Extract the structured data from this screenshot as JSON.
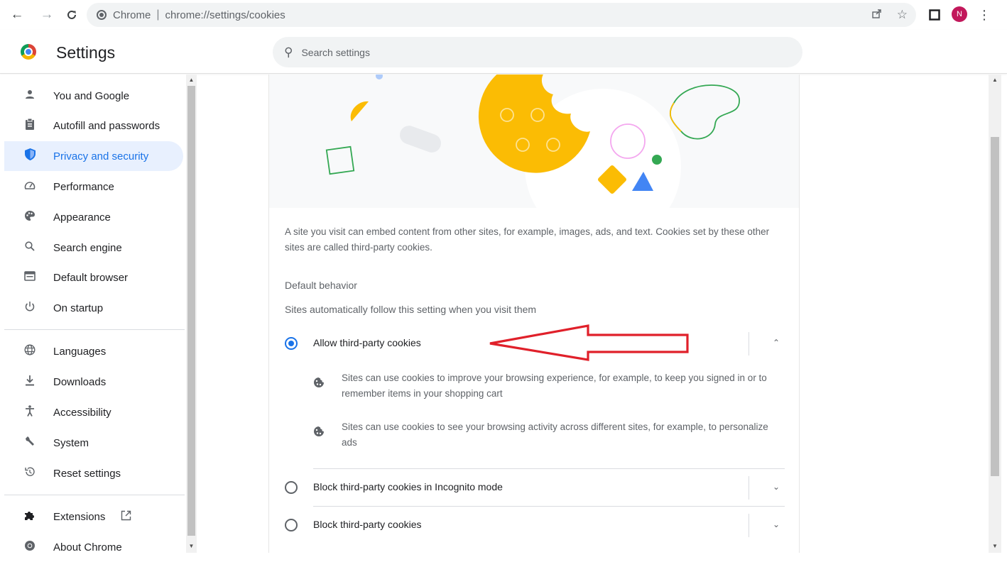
{
  "browser": {
    "site_name": "Chrome",
    "url": "chrome://settings/cookies",
    "profile_initial": "N",
    "icons": [
      "back-arrow-icon",
      "forward-arrow-icon",
      "reload-icon",
      "share-icon",
      "bookmark-star-icon",
      "side-panel-icon",
      "menu-dots-icon"
    ]
  },
  "header": {
    "title": "Settings",
    "search_placeholder": "Search settings"
  },
  "sidebar": {
    "items": [
      {
        "label": "You and Google",
        "icon": "person-icon"
      },
      {
        "label": "Autofill and passwords",
        "icon": "clipboard-icon"
      },
      {
        "label": "Privacy and security",
        "icon": "shield-icon",
        "active": true
      },
      {
        "label": "Performance",
        "icon": "speedometer-icon"
      },
      {
        "label": "Appearance",
        "icon": "palette-icon"
      },
      {
        "label": "Search engine",
        "icon": "search-icon"
      },
      {
        "label": "Default browser",
        "icon": "browser-window-icon"
      },
      {
        "label": "On startup",
        "icon": "power-icon"
      },
      {
        "label": "Languages",
        "icon": "globe-icon"
      },
      {
        "label": "Downloads",
        "icon": "download-icon"
      },
      {
        "label": "Accessibility",
        "icon": "accessibility-icon"
      },
      {
        "label": "System",
        "icon": "wrench-icon"
      },
      {
        "label": "Reset settings",
        "icon": "reset-icon"
      },
      {
        "label": "Extensions",
        "icon": "puzzle-icon"
      },
      {
        "label": "About Chrome",
        "icon": "chrome-icon"
      }
    ]
  },
  "main": {
    "description": "A site you visit can embed content from other sites, for example, images, ads, and text. Cookies set by these other sites are called third-party cookies.",
    "default_behavior_heading": "Default behavior",
    "default_behavior_sub": "Sites automatically follow this setting when you visit them",
    "options": [
      {
        "label": "Allow third-party cookies",
        "selected": true,
        "expanded": true
      },
      {
        "label": "Block third-party cookies in Incognito mode",
        "selected": false,
        "expanded": false
      },
      {
        "label": "Block third-party cookies",
        "selected": false,
        "expanded": false
      }
    ],
    "allow_details": [
      "Sites can use cookies to improve your browsing experience, for example, to keep you signed in or to remember items in your shopping cart",
      "Sites can use cookies to see your browsing activity across different sites, for example, to personalize ads"
    ]
  },
  "colors": {
    "accent": "#1a73e8",
    "active_nav_bg": "#e8f0fe",
    "annotation_arrow": "#e0202a",
    "cookie_yellow": "#fbbc04"
  }
}
